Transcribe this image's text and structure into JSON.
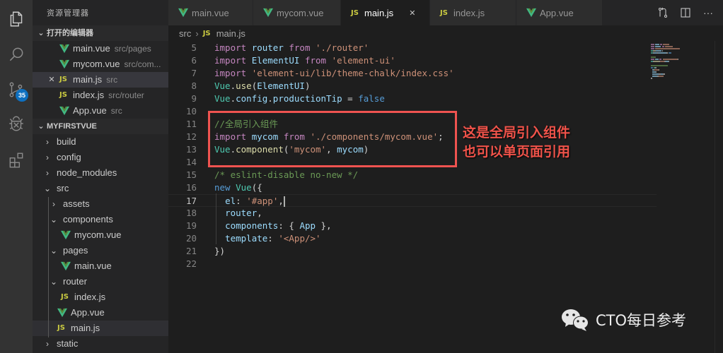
{
  "activity_bar": {
    "items": [
      {
        "name": "explorer",
        "icon": "files-icon"
      },
      {
        "name": "search",
        "icon": "search-icon"
      },
      {
        "name": "source-control",
        "icon": "git-branch-icon",
        "badge": "35"
      },
      {
        "name": "debug",
        "icon": "bug-icon"
      },
      {
        "name": "extensions",
        "icon": "extensions-icon"
      }
    ]
  },
  "sidebar": {
    "title": "资源管理器",
    "open_editors": {
      "title": "打开的编辑器",
      "items": [
        {
          "name": "main.vue",
          "path": "src/pages",
          "type": "vue"
        },
        {
          "name": "mycom.vue",
          "path": "src/com...",
          "type": "vue"
        },
        {
          "name": "main.js",
          "path": "src",
          "type": "js",
          "active": true
        },
        {
          "name": "index.js",
          "path": "src/router",
          "type": "js"
        },
        {
          "name": "App.vue",
          "path": "src",
          "type": "vue"
        }
      ]
    },
    "project": {
      "title": "MYFIRSTVUE",
      "tree": [
        {
          "label": "build",
          "kind": "folder",
          "open": false,
          "depth": 0
        },
        {
          "label": "config",
          "kind": "folder",
          "open": false,
          "depth": 0
        },
        {
          "label": "node_modules",
          "kind": "folder",
          "open": false,
          "depth": 0
        },
        {
          "label": "src",
          "kind": "folder",
          "open": true,
          "depth": 0
        },
        {
          "label": "assets",
          "kind": "folder",
          "open": false,
          "depth": 1
        },
        {
          "label": "components",
          "kind": "folder",
          "open": true,
          "depth": 1
        },
        {
          "label": "mycom.vue",
          "kind": "vue",
          "depth": 2
        },
        {
          "label": "pages",
          "kind": "folder",
          "open": true,
          "depth": 1
        },
        {
          "label": "main.vue",
          "kind": "vue",
          "depth": 2
        },
        {
          "label": "router",
          "kind": "folder",
          "open": true,
          "depth": 1
        },
        {
          "label": "index.js",
          "kind": "js",
          "depth": 2
        },
        {
          "label": "App.vue",
          "kind": "vue",
          "depth": 1
        },
        {
          "label": "main.js",
          "kind": "js",
          "depth": 1,
          "selected": true
        },
        {
          "label": "static",
          "kind": "folder",
          "open": false,
          "depth": 0
        }
      ]
    }
  },
  "tabs": [
    {
      "label": "main.vue",
      "type": "vue"
    },
    {
      "label": "mycom.vue",
      "type": "vue"
    },
    {
      "label": "main.js",
      "type": "js",
      "active": true
    },
    {
      "label": "index.js",
      "type": "js"
    },
    {
      "label": "App.vue",
      "type": "vue"
    }
  ],
  "tab_actions": [
    "open-changes-icon",
    "split-editor-icon",
    "more-actions-icon"
  ],
  "breadcrumb": {
    "folder": "src",
    "file": "main.js"
  },
  "editor": {
    "current_line": 17,
    "lines": [
      {
        "n": "5",
        "tokens": [
          [
            "kw",
            "import"
          ],
          [
            "pl",
            " "
          ],
          [
            "id",
            "router"
          ],
          [
            "pl",
            " "
          ],
          [
            "kw",
            "from"
          ],
          [
            "pl",
            " "
          ],
          [
            "st",
            "'./router'"
          ]
        ]
      },
      {
        "n": "6",
        "tokens": [
          [
            "kw",
            "import"
          ],
          [
            "pl",
            " "
          ],
          [
            "id",
            "ElementUI"
          ],
          [
            "pl",
            " "
          ],
          [
            "kw",
            "from"
          ],
          [
            "pl",
            " "
          ],
          [
            "st",
            "'element-ui'"
          ]
        ]
      },
      {
        "n": "7",
        "tokens": [
          [
            "kw",
            "import"
          ],
          [
            "pl",
            " "
          ],
          [
            "st",
            "'element-ui/lib/theme-chalk/index.css'"
          ]
        ]
      },
      {
        "n": "8",
        "tokens": [
          [
            "ty",
            "Vue"
          ],
          [
            "pl",
            "."
          ],
          [
            "fn",
            "use"
          ],
          [
            "pl",
            "("
          ],
          [
            "id",
            "ElementUI"
          ],
          [
            "pl",
            ")"
          ]
        ]
      },
      {
        "n": "9",
        "tokens": [
          [
            "ty",
            "Vue"
          ],
          [
            "pl",
            "."
          ],
          [
            "id",
            "config"
          ],
          [
            "pl",
            "."
          ],
          [
            "id",
            "productionTip"
          ],
          [
            "pl",
            " = "
          ],
          [
            "kb",
            "false"
          ]
        ]
      },
      {
        "n": "10",
        "tokens": []
      },
      {
        "n": "11",
        "tokens": [
          [
            "cm",
            "//全局引入组件"
          ]
        ]
      },
      {
        "n": "12",
        "tokens": [
          [
            "kw",
            "import"
          ],
          [
            "pl",
            " "
          ],
          [
            "id",
            "mycom"
          ],
          [
            "pl",
            " "
          ],
          [
            "kw",
            "from"
          ],
          [
            "pl",
            " "
          ],
          [
            "st",
            "'./components/mycom.vue'"
          ],
          [
            "pl",
            ";"
          ]
        ]
      },
      {
        "n": "13",
        "tokens": [
          [
            "ty",
            "Vue"
          ],
          [
            "pl",
            "."
          ],
          [
            "fn",
            "component"
          ],
          [
            "pl",
            "("
          ],
          [
            "st",
            "'mycom'"
          ],
          [
            "pl",
            ", "
          ],
          [
            "id",
            "mycom"
          ],
          [
            "pl",
            ")"
          ]
        ]
      },
      {
        "n": "14",
        "tokens": []
      },
      {
        "n": "15",
        "tokens": [
          [
            "cm",
            "/* eslint-disable no-new */"
          ]
        ]
      },
      {
        "n": "16",
        "tokens": [
          [
            "kb",
            "new"
          ],
          [
            "pl",
            " "
          ],
          [
            "ty",
            "Vue"
          ],
          [
            "pl",
            "({"
          ]
        ]
      },
      {
        "n": "17",
        "tokens": [
          [
            "pl",
            "  "
          ],
          [
            "id",
            "el"
          ],
          [
            "pl",
            ": "
          ],
          [
            "st",
            "'#app'"
          ],
          [
            "pl",
            ","
          ]
        ],
        "cursor": true
      },
      {
        "n": "18",
        "tokens": [
          [
            "pl",
            "  "
          ],
          [
            "id",
            "router"
          ],
          [
            "pl",
            ","
          ]
        ]
      },
      {
        "n": "19",
        "tokens": [
          [
            "pl",
            "  "
          ],
          [
            "id",
            "components"
          ],
          [
            "pl",
            ": { "
          ],
          [
            "id",
            "App"
          ],
          [
            "pl",
            " },"
          ]
        ]
      },
      {
        "n": "20",
        "tokens": [
          [
            "pl",
            "  "
          ],
          [
            "id",
            "template"
          ],
          [
            "pl",
            ": "
          ],
          [
            "st",
            "'<App/>'"
          ]
        ]
      },
      {
        "n": "21",
        "tokens": [
          [
            "pl",
            "})"
          ]
        ]
      },
      {
        "n": "22",
        "tokens": []
      }
    ]
  },
  "annotation": {
    "line1": "这是全局引入组件",
    "line2": "也可以单页面引用",
    "color": "#f0534a"
  },
  "watermark": {
    "text": "CTO每日参考",
    "icon": "wechat-icon"
  },
  "colors": {
    "vue_green": "#41b883",
    "js_yellow": "#cbcb41",
    "badge_blue": "#0e70c0",
    "highlight_red": "#ef5350"
  }
}
